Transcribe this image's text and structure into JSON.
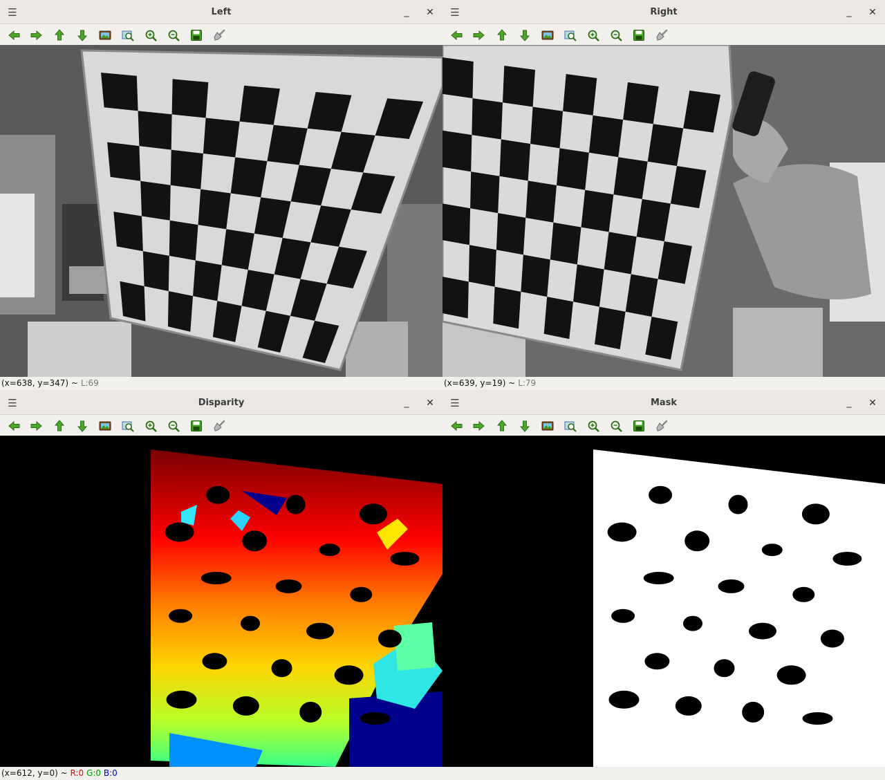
{
  "windows": {
    "left": {
      "title": "Left",
      "status_coord": "(x=638, y=347) ~",
      "status_value": "L:69"
    },
    "right": {
      "title": "Right",
      "status_coord": "(x=639, y=19) ~",
      "status_value": "L:79"
    },
    "disparity": {
      "title": "Disparity",
      "status_coord": "(x=612, y=0) ~",
      "status_r": "R:0",
      "status_g": "G:0",
      "status_b": "B:0"
    },
    "mask": {
      "title": "Mask"
    }
  },
  "toolbar_icons": [
    "arrow-left-icon",
    "arrow-right-icon",
    "arrow-up-icon",
    "arrow-down-icon",
    "image-icon",
    "zoom-fit-icon",
    "zoom-in-icon",
    "zoom-out-icon",
    "save-icon",
    "brush-icon"
  ],
  "colors": {
    "toolbar_green": "#3f9e1e",
    "title_text": "#3c3c3c",
    "status_red": "#e00000",
    "status_green": "#00a000",
    "status_blue": "#0000d0"
  }
}
